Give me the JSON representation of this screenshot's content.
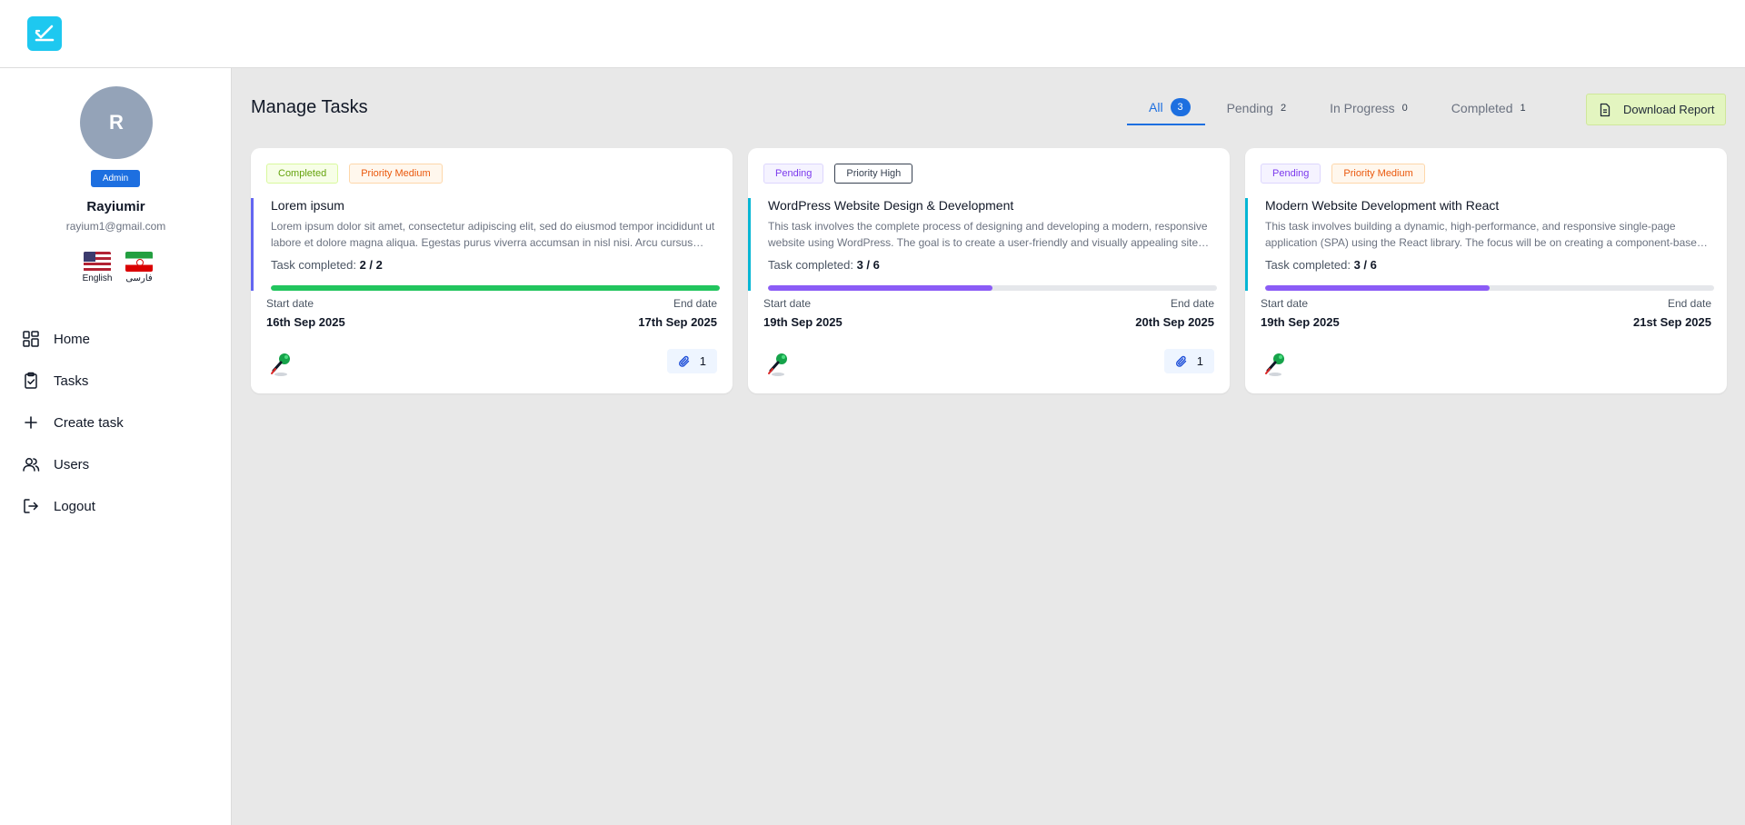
{
  "user": {
    "initial": "R",
    "role": "Admin",
    "name": "Rayiumir",
    "email": "rayium1@gmail.com"
  },
  "languages": [
    {
      "label": "English"
    },
    {
      "label": "فارسی"
    }
  ],
  "nav": [
    {
      "label": "Home",
      "icon": "grid-icon"
    },
    {
      "label": "Tasks",
      "icon": "clipboard-check-icon"
    },
    {
      "label": "Create task",
      "icon": "plus-icon"
    },
    {
      "label": "Users",
      "icon": "users-icon"
    },
    {
      "label": "Logout",
      "icon": "logout-icon"
    }
  ],
  "main": {
    "title": "Manage Tasks",
    "tabs": [
      {
        "label": "All",
        "count": "3",
        "active": true
      },
      {
        "label": "Pending",
        "count": "2"
      },
      {
        "label": "In Progress",
        "count": "0"
      },
      {
        "label": "Completed",
        "count": "1"
      }
    ],
    "download_label": "Download Report"
  },
  "labels": {
    "start_date": "Start date",
    "end_date": "End date",
    "task_completed": "Task completed:"
  },
  "colors": {
    "accent": "#1d6fe0",
    "completed_bar": "#22c55e",
    "progress_bar": "#8b5cf6",
    "card_border_blue": "#6366f1",
    "card_border_cyan": "#06b6d4"
  },
  "tasks": [
    {
      "status": "Completed",
      "priority": "Priority Medium",
      "title": "Lorem ipsum",
      "description": "Lorem ipsum dolor sit amet, consectetur adipiscing elit, sed do eiusmod tempor incididunt ut labore et dolore magna aliqua. Egestas purus viverra accumsan in nisl nisi. Arcu cursus vitae congue mauris rhoncus aenean vel elit scelerisque.",
      "progress": "2 / 2",
      "progress_fraction": 1.0,
      "start_date": "16th Sep 2025",
      "end_date": "17th Sep 2025",
      "attachments": "1"
    },
    {
      "status": "Pending",
      "priority": "Priority High",
      "title": "WordPress Website Design & Development",
      "description": "This task involves the complete process of designing and developing a modern, responsive website using WordPress. The goal is to create a user-friendly and visually appealing site that meets the client's requirements.",
      "progress": "3 / 6",
      "progress_fraction": 0.5,
      "start_date": "19th Sep 2025",
      "end_date": "20th Sep 2025",
      "attachments": "1"
    },
    {
      "status": "Pending",
      "priority": "Priority Medium",
      "title": "Modern Website Development with React",
      "description": "This task involves building a dynamic, high-performance, and responsive single-page application (SPA) using the React library. The focus will be on creating a component-based architecture for maintainability.",
      "progress": "3 / 6",
      "progress_fraction": 0.5,
      "start_date": "19th Sep 2025",
      "end_date": "21st Sep 2025",
      "attachments": ""
    }
  ]
}
